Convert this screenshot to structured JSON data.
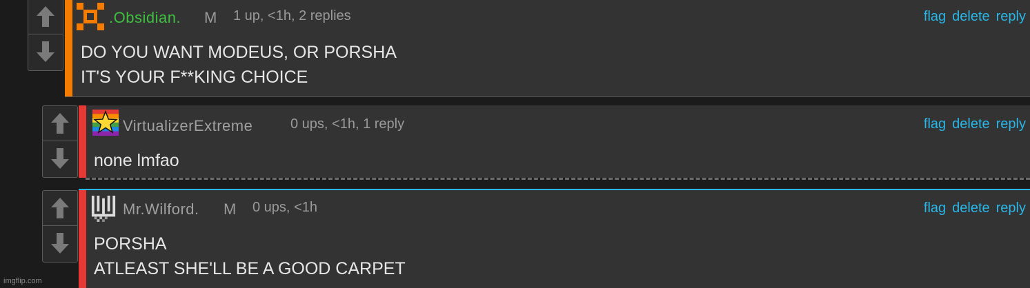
{
  "comments": [
    {
      "username": ".Obsidian.",
      "username_color": "#3fbf3f",
      "mod_tag": "M",
      "meta": "1 up, <1h, 2 replies",
      "accent_color": "#f57c00",
      "avatar_icon": "orange-pixel-x-icon",
      "lines": [
        "DO YOU WANT MODEUS, OR PORSHA",
        "IT'S YOUR F**KING CHOICE"
      ],
      "actions": {
        "flag": "flag",
        "delete": "delete",
        "reply": "reply"
      }
    },
    {
      "username": "VirtualizerExtreme",
      "username_color": "#a0a0a0",
      "mod_tag": "",
      "meta": "0 ups, <1h, 1 reply",
      "accent_color": "#e53935",
      "avatar_icon": "rainbow-star-icon",
      "lines": [
        "none lmfao"
      ],
      "actions": {
        "flag": "flag",
        "delete": "delete",
        "reply": "reply"
      }
    },
    {
      "username": "Mr.Wilford.",
      "username_color": "#a0a0a0",
      "mod_tag": "M",
      "meta": "0 ups, <1h",
      "accent_color": "#e53935",
      "avatar_icon": "pixel-w-icon",
      "lines": [
        "PORSHA",
        "ATLEAST SHE'LL BE A GOOD CARPET"
      ],
      "actions": {
        "flag": "flag",
        "delete": "delete",
        "reply": "reply"
      }
    }
  ],
  "watermark": "imgflip.com",
  "colors": {
    "link": "#29b6e8",
    "highlight_border": "#29b6e8"
  }
}
